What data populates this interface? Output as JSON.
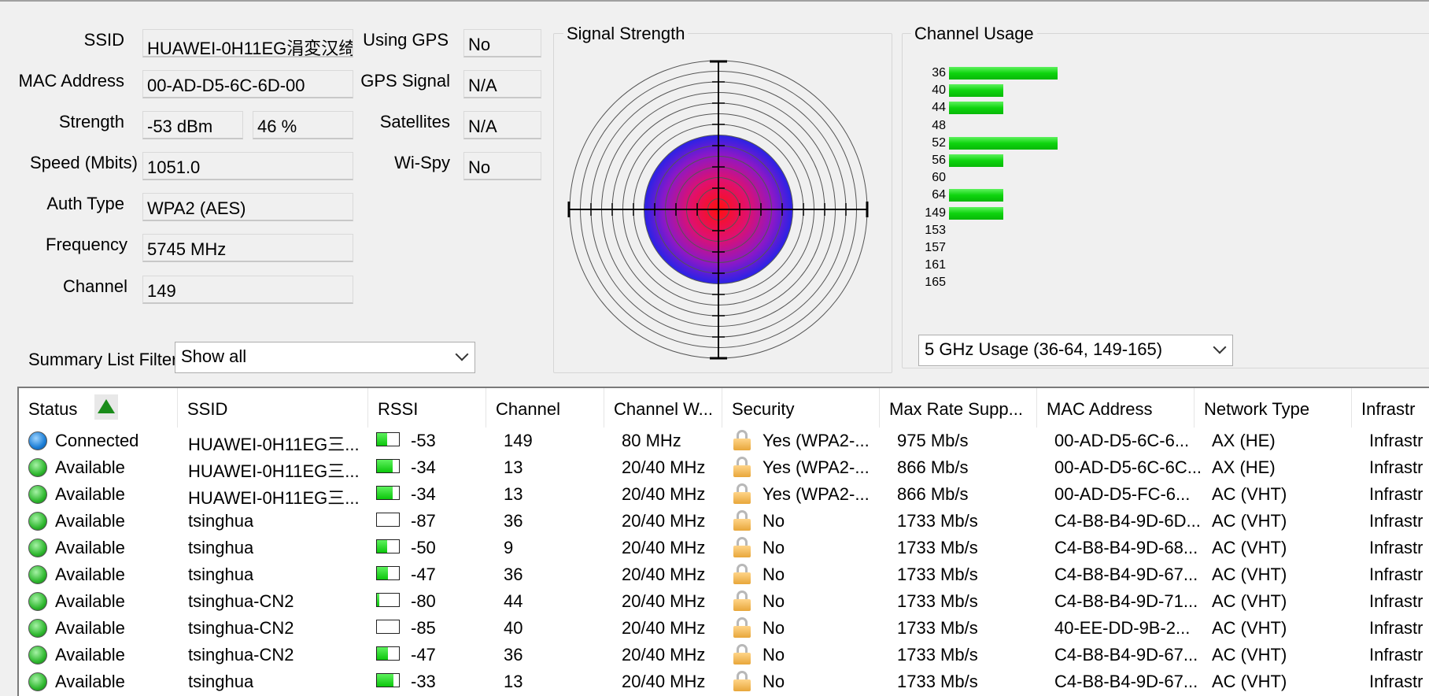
{
  "info": {
    "ssid_label": "SSID",
    "ssid_value": "HUAWEI-0H11EG涓変汉绮",
    "mac_label": "MAC Address",
    "mac_value": "00-AD-D5-6C-6D-00",
    "strength_label": "Strength",
    "strength_dbm": "-53 dBm",
    "strength_pct": "46 %",
    "speed_label": "Speed (Mbits)",
    "speed_value": "1051.0",
    "auth_label": "Auth Type",
    "auth_value": "WPA2 (AES)",
    "freq_label": "Frequency",
    "freq_value": "5745 MHz",
    "channel_label": "Channel",
    "channel_value": "149",
    "gps_label": "Using GPS",
    "gps_value": "No",
    "gps_signal_label": "GPS Signal",
    "gps_signal_value": "N/A",
    "satellites_label": "Satellites",
    "satellites_value": "N/A",
    "wispy_label": "Wi-Spy",
    "wispy_value": "No"
  },
  "signal_strength": {
    "title": "Signal Strength",
    "percent": 46
  },
  "channel_usage": {
    "title": "Channel Usage",
    "channels": [
      {
        "ch": "36",
        "level": 4
      },
      {
        "ch": "40",
        "level": 2
      },
      {
        "ch": "44",
        "level": 2
      },
      {
        "ch": "48",
        "level": 0
      },
      {
        "ch": "52",
        "level": 4
      },
      {
        "ch": "56",
        "level": 2
      },
      {
        "ch": "60",
        "level": 0
      },
      {
        "ch": "64",
        "level": 2
      },
      {
        "ch": "149",
        "level": 2
      },
      {
        "ch": "153",
        "level": 0
      },
      {
        "ch": "157",
        "level": 0
      },
      {
        "ch": "161",
        "level": 0
      },
      {
        "ch": "165",
        "level": 0
      }
    ],
    "band_select": "5 GHz Usage (36-64, 149-165)"
  },
  "filter": {
    "label": "Summary List Filter:",
    "value": "Show all"
  },
  "table": {
    "headers": [
      "Status",
      "SSID",
      "RSSI",
      "Channel",
      "Channel W...",
      "Security",
      "Max Rate Supp...",
      "MAC Address",
      "Network Type",
      "Infrastr"
    ],
    "rows": [
      {
        "status": "Connected",
        "dot": "blue",
        "ssid": "HUAWEI-0H11EG三...",
        "rssi": "-53",
        "rssi_level": 0.45,
        "channel": "149",
        "width": "80 MHz",
        "security": "Yes (WPA2-...",
        "rate": "975 Mb/s",
        "mac": "00-AD-D5-6C-6...",
        "ntype": "AX (HE)",
        "infra": "Infrastr"
      },
      {
        "status": "Available",
        "dot": "green",
        "ssid": "HUAWEI-0H11EG三...",
        "rssi": "-34",
        "rssi_level": 0.7,
        "channel": "13",
        "width": "20/40 MHz",
        "security": "Yes (WPA2-...",
        "rate": "866 Mb/s",
        "mac": "00-AD-D5-6C-6C...",
        "ntype": "AX (HE)",
        "infra": "Infrastr"
      },
      {
        "status": "Available",
        "dot": "green",
        "ssid": "HUAWEI-0H11EG三...",
        "rssi": "-34",
        "rssi_level": 0.7,
        "channel": "13",
        "width": "20/40 MHz",
        "security": "Yes (WPA2-...",
        "rate": "866 Mb/s",
        "mac": "00-AD-D5-FC-6...",
        "ntype": "AC (VHT)",
        "infra": "Infrastr"
      },
      {
        "status": "Available",
        "dot": "green",
        "ssid": "tsinghua",
        "rssi": "-87",
        "rssi_level": 0,
        "channel": "36",
        "width": "20/40 MHz",
        "security": "No",
        "rate": "1733 Mb/s",
        "mac": "C4-B8-B4-9D-6D...",
        "ntype": "AC (VHT)",
        "infra": "Infrastr"
      },
      {
        "status": "Available",
        "dot": "green",
        "ssid": "tsinghua",
        "rssi": "-50",
        "rssi_level": 0.45,
        "channel": "9",
        "width": "20/40 MHz",
        "security": "No",
        "rate": "1733 Mb/s",
        "mac": "C4-B8-B4-9D-68...",
        "ntype": "AC (VHT)",
        "infra": "Infrastr"
      },
      {
        "status": "Available",
        "dot": "green",
        "ssid": "tsinghua",
        "rssi": "-47",
        "rssi_level": 0.5,
        "channel": "36",
        "width": "20/40 MHz",
        "security": "No",
        "rate": "1733 Mb/s",
        "mac": "C4-B8-B4-9D-67...",
        "ntype": "AC (VHT)",
        "infra": "Infrastr"
      },
      {
        "status": "Available",
        "dot": "green",
        "ssid": "tsinghua-CN2",
        "rssi": "-80",
        "rssi_level": 0.1,
        "channel": "44",
        "width": "20/40 MHz",
        "security": "No",
        "rate": "1733 Mb/s",
        "mac": "C4-B8-B4-9D-71...",
        "ntype": "AC (VHT)",
        "infra": "Infrastr"
      },
      {
        "status": "Available",
        "dot": "green",
        "ssid": "tsinghua-CN2",
        "rssi": "-85",
        "rssi_level": 0,
        "channel": "40",
        "width": "20/40 MHz",
        "security": "No",
        "rate": "1733 Mb/s",
        "mac": "40-EE-DD-9B-2...",
        "ntype": "AC (VHT)",
        "infra": "Infrastr"
      },
      {
        "status": "Available",
        "dot": "green",
        "ssid": "tsinghua-CN2",
        "rssi": "-47",
        "rssi_level": 0.5,
        "channel": "36",
        "width": "20/40 MHz",
        "security": "No",
        "rate": "1733 Mb/s",
        "mac": "C4-B8-B4-9D-67...",
        "ntype": "AC (VHT)",
        "infra": "Infrastr"
      },
      {
        "status": "Available",
        "dot": "green",
        "ssid": "tsinghua",
        "rssi": "-33",
        "rssi_level": 0.75,
        "channel": "13",
        "width": "20/40 MHz",
        "security": "No",
        "rate": "1733 Mb/s",
        "mac": "C4-B8-B4-9D-67...",
        "ntype": "AC (VHT)",
        "infra": "Infrastr"
      }
    ]
  }
}
